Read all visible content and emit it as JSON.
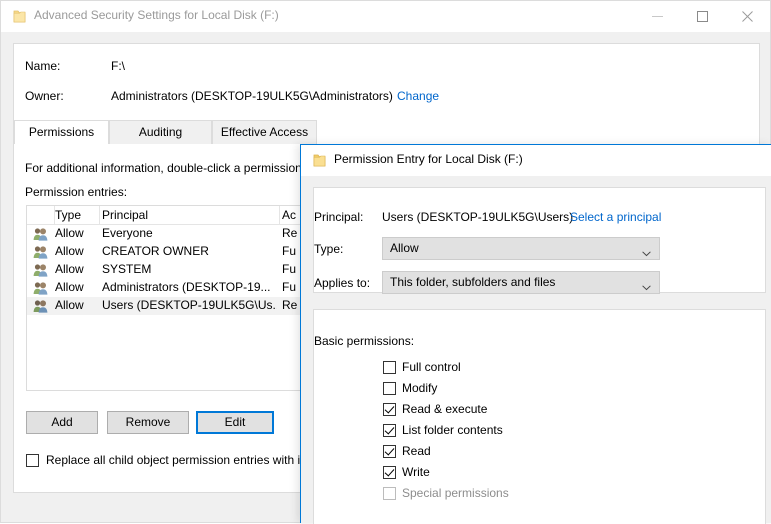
{
  "advanced_window": {
    "title": "Advanced Security Settings for Local Disk (F:)",
    "title_icon": "folder-icon",
    "controls": {
      "minimize": "minimize-icon",
      "maximize": "maximize-icon",
      "close": "close-icon"
    },
    "name_label": "Name:",
    "name_value": "F:\\",
    "owner_label": "Owner:",
    "owner_value": "Administrators (DESKTOP-19ULK5G\\Administrators)",
    "owner_change_link": "Change",
    "tabs": [
      {
        "label": "Permissions",
        "active": true
      },
      {
        "label": "Auditing",
        "active": false
      },
      {
        "label": "Effective Access",
        "active": false
      }
    ],
    "info_text": "For additional information, double-click a permission",
    "entries_label": "Permission entries:",
    "columns": [
      "Type",
      "Principal",
      "Ac"
    ],
    "rows": [
      {
        "icon": "group-icon",
        "type": "Allow",
        "principal": "Everyone",
        "access": "Re",
        "selected": false
      },
      {
        "icon": "group-icon",
        "type": "Allow",
        "principal": "CREATOR OWNER",
        "access": "Fu",
        "selected": false
      },
      {
        "icon": "group-icon",
        "type": "Allow",
        "principal": "SYSTEM",
        "access": "Fu",
        "selected": false
      },
      {
        "icon": "group-icon",
        "type": "Allow",
        "principal": "Administrators (DESKTOP-19...",
        "access": "Fu",
        "selected": false
      },
      {
        "icon": "group-icon",
        "type": "Allow",
        "principal": "Users (DESKTOP-19ULK5G\\Us...",
        "access": "Re",
        "selected": true
      }
    ],
    "buttons": {
      "add": "Add",
      "remove": "Remove",
      "edit": "Edit"
    },
    "replace_checkbox": {
      "label": "Replace all child object permission entries with i",
      "checked": false
    }
  },
  "permission_entry_window": {
    "title": "Permission Entry for Local Disk (F:)",
    "title_icon": "folder-icon",
    "principal_label": "Principal:",
    "principal_value": "Users (DESKTOP-19ULK5G\\Users)",
    "select_principal_link": "Select a principal",
    "type_label": "Type:",
    "type_value": "Allow",
    "applies_label": "Applies to:",
    "applies_value": "This folder, subfolders and files",
    "basic_permissions_label": "Basic permissions:",
    "permissions": [
      {
        "label": "Full control",
        "checked": false,
        "disabled": false
      },
      {
        "label": "Modify",
        "checked": false,
        "disabled": false
      },
      {
        "label": "Read & execute",
        "checked": true,
        "disabled": false
      },
      {
        "label": "List folder contents",
        "checked": true,
        "disabled": false
      },
      {
        "label": "Read",
        "checked": true,
        "disabled": false
      },
      {
        "label": "Write",
        "checked": true,
        "disabled": false
      },
      {
        "label": "Special permissions",
        "checked": false,
        "disabled": true
      }
    ]
  },
  "colors": {
    "accent": "#0078d7",
    "link": "#0066cc",
    "inactive_title": "#9a9a9a",
    "dialog_bg": "#f0f0f0",
    "panel_bg": "#ffffff",
    "button_face": "#e1e1e1"
  }
}
